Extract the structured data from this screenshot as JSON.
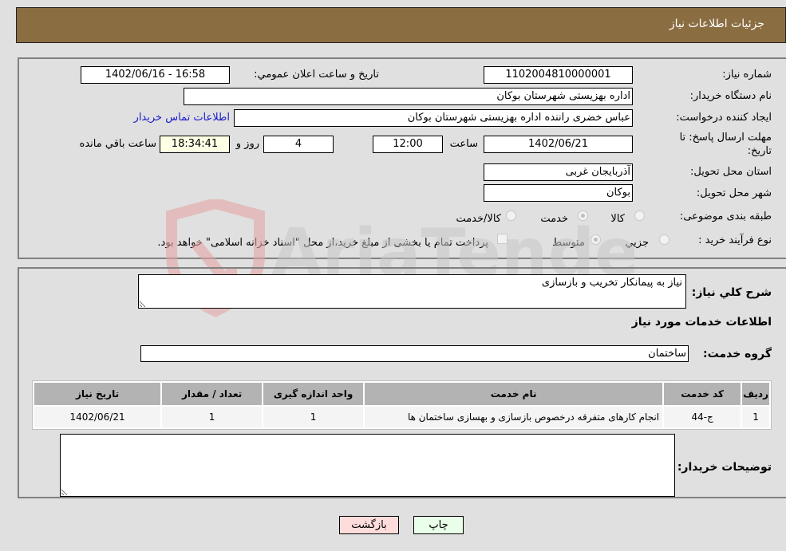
{
  "header": {
    "title": "جزئیات اطلاعات نیاز"
  },
  "form": {
    "need_number": {
      "label": "شماره نیاز:",
      "value": "1102004810000001"
    },
    "announce_datetime": {
      "label": "تاریخ و ساعت اعلان عمومي:",
      "value": "1402/06/16 - 16:58"
    },
    "buyer_org": {
      "label": "نام دستگاه خریدار:",
      "value": "اداره بهزیستی شهرستان بوکان"
    },
    "requester": {
      "label": "ایجاد کننده درخواست:",
      "value": "عباس خضری راننده اداره بهزیستی شهرستان بوکان"
    },
    "contact_link": "اطلاعات تماس خریدار",
    "deadline": {
      "label_line1": "مهلت ارسال پاسخ: تا",
      "label_line2": "تاریخ:",
      "date": "1402/06/21",
      "time_label": "ساعت",
      "time": "12:00",
      "days": "4",
      "days_label": "روز و",
      "remaining": "18:34:41",
      "remaining_label": "ساعت باقي مانده"
    },
    "province": {
      "label": "استان محل تحویل:",
      "value": "آذربایجان غربی"
    },
    "city": {
      "label": "شهر محل تحویل:",
      "value": "بوکان"
    },
    "category": {
      "label": "طبقه بندی موضوعی:",
      "options": [
        "کالا",
        "خدمت",
        "کالا/خدمت"
      ],
      "selected": "خدمت"
    },
    "process": {
      "label": "نوع فرآیند خرید :",
      "options": [
        "جزيي",
        "متوسط"
      ],
      "selected": "متوسط",
      "treasury_note": "پرداخت تمام یا بخشی از مبلغ خرید،از محل \"اسناد خزانه اسلامی\" خواهد بود."
    }
  },
  "details": {
    "description_label": "شرح کلي نياز:",
    "description": "نیاز به پیمانکار تخریب و بازسازی",
    "services_heading": "اطلاعات خدمات مورد نياز",
    "service_group_label": "گروه خدمت:",
    "service_group": "ساختمان",
    "table": {
      "headers": [
        "رديف",
        "کد خدمت",
        "نام خدمت",
        "واحد اندازه گیری",
        "تعداد / مقدار",
        "تاریخ نیاز"
      ],
      "rows": [
        [
          "1",
          "ج-44",
          "انجام کارهای متفرقه درخصوص بازسازی و بهسازی ساختمان ها",
          "1",
          "1",
          "1402/06/21"
        ]
      ]
    },
    "buyer_notes_label": "توضيحات خريدار:",
    "buyer_notes": ""
  },
  "buttons": {
    "print": "چاپ",
    "back": "بازگشت"
  },
  "watermark": "AriaTender.neT",
  "colors": {
    "header_bg": "#8b6d42",
    "print_bg": "#eaffea",
    "back_bg": "#ffdcdc",
    "link": "#1a1acc"
  }
}
